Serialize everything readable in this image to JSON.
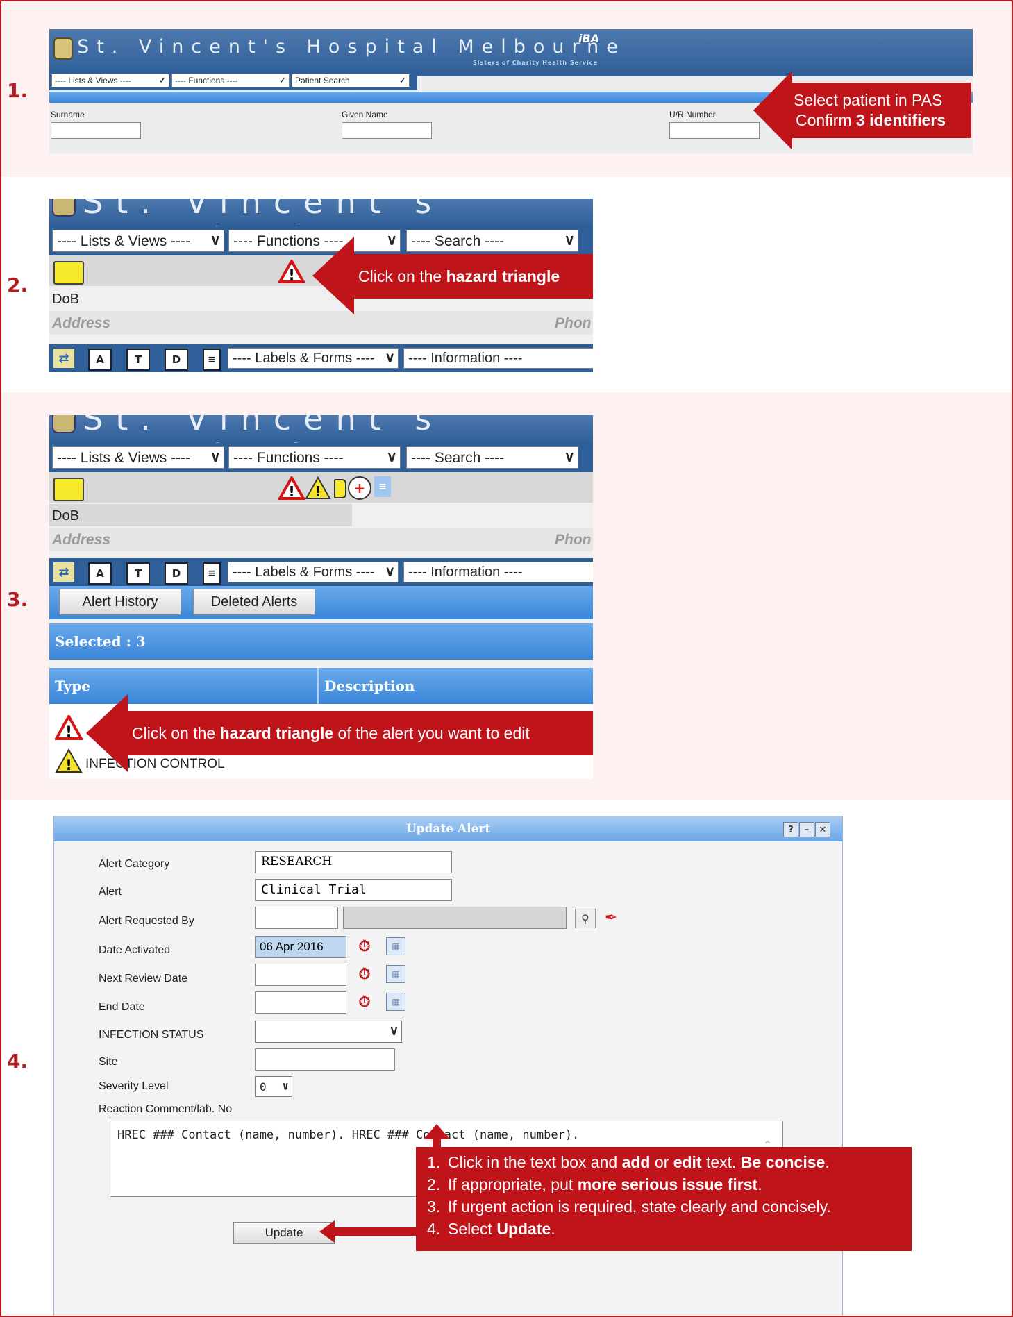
{
  "steps": [
    "1.",
    "2.",
    "3.",
    "4."
  ],
  "step1": {
    "banner_title": "St. Vincent's Hospital Melbourne",
    "banner_sub": "Sisters of Charity Health Service",
    "banner_logo": "iBA",
    "menus": [
      "---- Lists & Views ----",
      "---- Functions ----",
      "Patient Search"
    ],
    "fields": [
      "Surname",
      "Given Name",
      "U/R Number"
    ],
    "callout": {
      "line1": "Select patient in PAS",
      "line2_pre": "Confirm ",
      "line2_bold": "3 identifiers"
    }
  },
  "step2": {
    "banner_title": "St. Vincent's Hospital M",
    "menus": [
      "---- Lists & Views ----",
      "---- Functions ----",
      "---- Search ----"
    ],
    "dob": "DoB",
    "address": "Address",
    "phone": "Phon",
    "labels_forms": "---- Labels & Forms ----",
    "information": "---- Information ----",
    "callout": {
      "pre": "Click on the ",
      "bold": "hazard triangle"
    }
  },
  "step3": {
    "banner_title": "St. Vincent's Hospital M",
    "menus": [
      "---- Lists & Views ----",
      "---- Functions ----",
      "---- Search ----"
    ],
    "dob": "DoB",
    "address": "Address",
    "phone": "Phon",
    "labels_forms": "---- Labels & Forms ----",
    "information": "---- Information ----",
    "buttons": [
      "Alert History",
      "Deleted Alerts"
    ],
    "selected": "Selected : 3",
    "col_type": "Type",
    "col_desc": "Description",
    "row2": "INFECTION CONTROL",
    "callout": {
      "pre": "Click on the ",
      "bold": "hazard triangle",
      "post": " of the alert you want to edit"
    }
  },
  "step4": {
    "window_title": "Update Alert",
    "labels": [
      "Alert Category",
      "Alert",
      "Alert Requested By",
      "Date Activated",
      "Next Review Date",
      "End Date",
      "INFECTION STATUS",
      "Site",
      "Severity Level",
      "Reaction Comment/lab. No"
    ],
    "category_value": "RESEARCH",
    "alert_value": "Clinical Trial",
    "date_activated": "06 Apr 2016",
    "severity": "0",
    "comment": "HREC ### Contact (name, number). HREC ### Contact (name, number).",
    "update_button": "Update",
    "callout": [
      {
        "n": "1.",
        "parts": [
          [
            "Click in the text box and ",
            false
          ],
          [
            "add",
            true
          ],
          [
            " or ",
            false
          ],
          [
            "edit",
            true
          ],
          [
            " text. ",
            false
          ],
          [
            "Be concise",
            true
          ],
          [
            ".",
            false
          ]
        ]
      },
      {
        "n": "2.",
        "parts": [
          [
            "If appropriate, put ",
            false
          ],
          [
            "more serious issue first",
            true
          ],
          [
            ".",
            false
          ]
        ]
      },
      {
        "n": "3.",
        "parts": [
          [
            "If urgent action is required, state clearly and concisely.",
            false
          ]
        ]
      },
      {
        "n": "4.",
        "parts": [
          [
            "Select ",
            false
          ],
          [
            "Update",
            true
          ],
          [
            ".",
            false
          ]
        ]
      }
    ]
  },
  "colors": {
    "accent_red": "#c0141b",
    "border_red": "#b01d22",
    "banner_blue": "#3a6aa5",
    "pink_band": "#fdf1f1"
  }
}
